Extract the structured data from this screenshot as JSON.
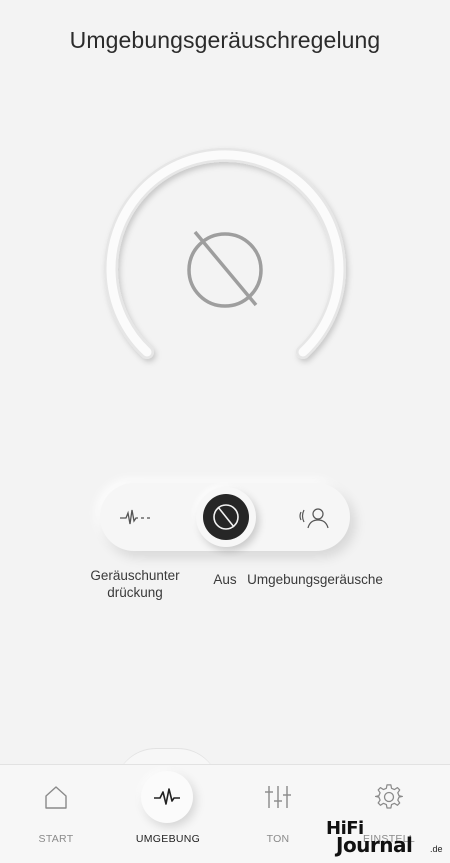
{
  "header": {
    "title": "Umgebungsgeräuschregelung"
  },
  "dial": {
    "center_icon": "off-icon"
  },
  "mode_selector": {
    "selected": "Aus",
    "options": [
      {
        "icon": "noise-suppression-icon",
        "label": "Geräuschunter\ndrückung"
      },
      {
        "icon": "off-icon",
        "label": "Aus"
      },
      {
        "icon": "ambient-sound-icon",
        "label": "Umgebungsgeräusche"
      }
    ]
  },
  "nav": {
    "items": [
      {
        "icon": "home-icon",
        "label": "START"
      },
      {
        "icon": "waveform-icon",
        "label": "UMGEBUNG",
        "active": true
      },
      {
        "icon": "equalizer-icon",
        "label": "TON"
      },
      {
        "icon": "gear-icon",
        "label": "EINSTELL"
      }
    ]
  },
  "watermark": {
    "line1": "HiFi",
    "line2": "Journal",
    "suffix": ".de"
  }
}
